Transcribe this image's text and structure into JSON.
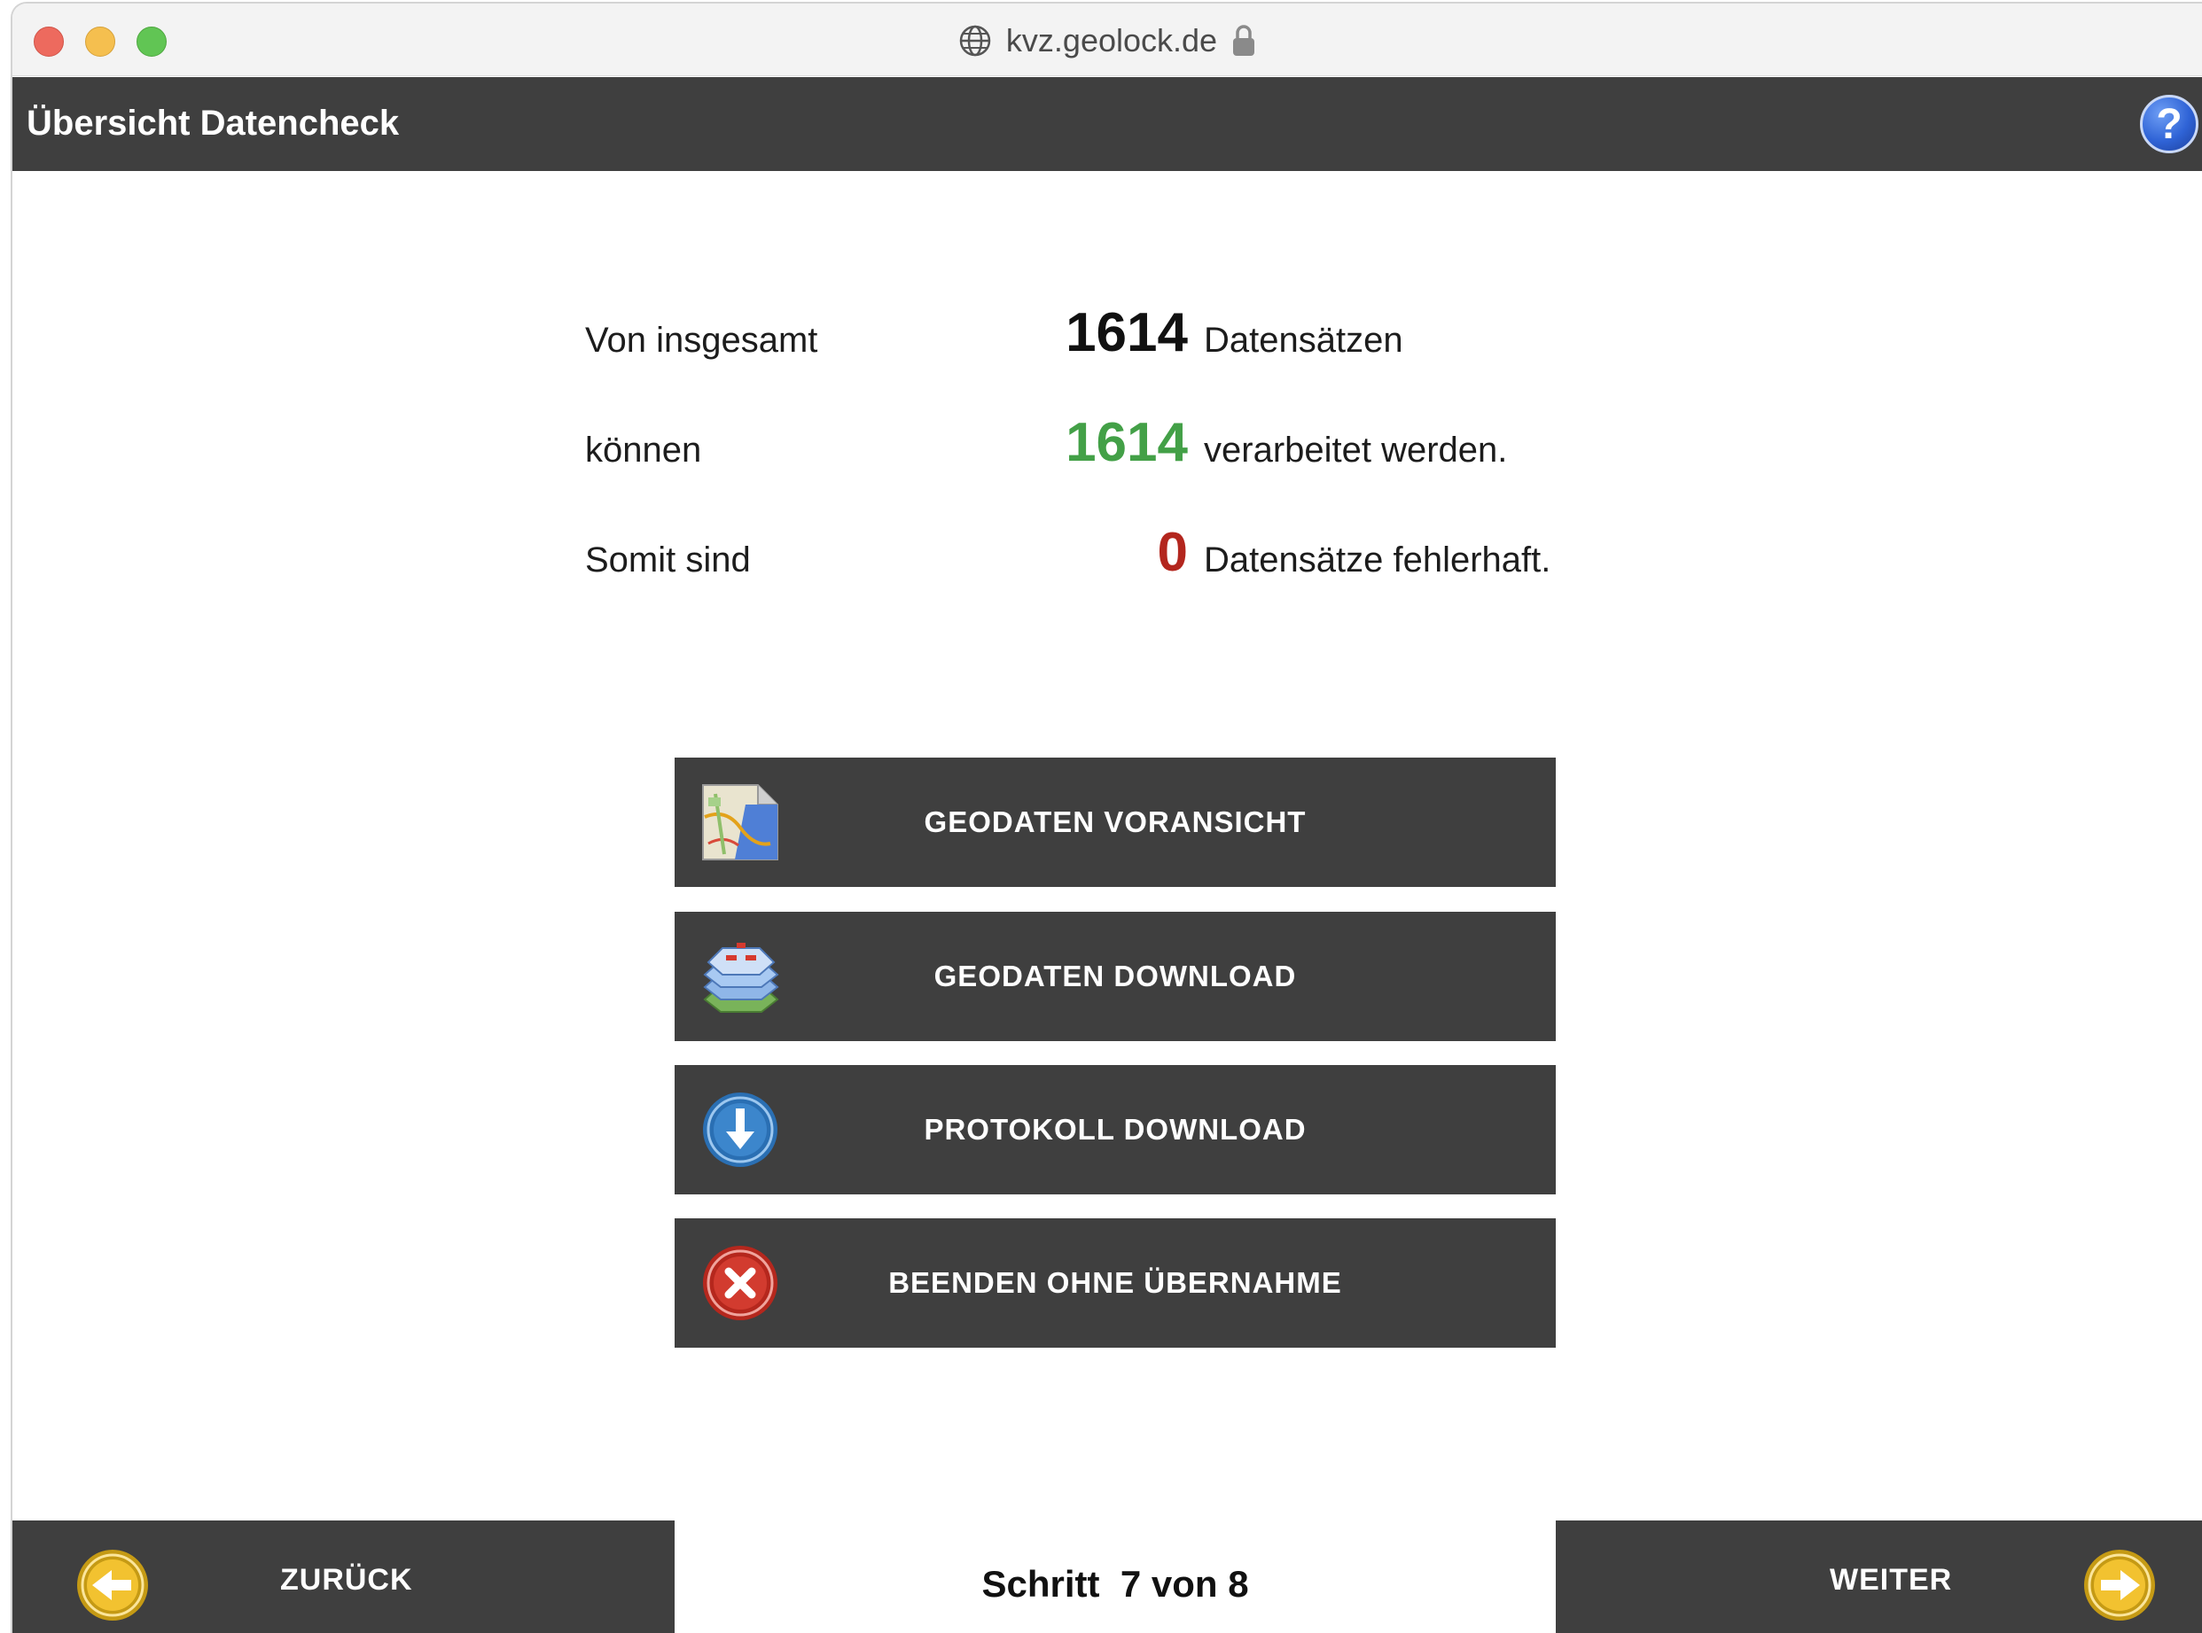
{
  "browser": {
    "url": "kvz.geolock.de"
  },
  "header": {
    "title": "Übersicht Datencheck",
    "help_label": "?"
  },
  "summary": {
    "rows": [
      {
        "label": "Von insgesamt",
        "value": "1614",
        "suffix": "Datensätzen",
        "color": "#111111"
      },
      {
        "label": "können",
        "value": "1614",
        "suffix": "verarbeitet werden.",
        "color": "#43a047"
      },
      {
        "label": "Somit sind",
        "value": "0",
        "suffix": "Datensätze fehlerhaft.",
        "color": "#b3261e"
      }
    ]
  },
  "actions": [
    {
      "label": "GEODATEN VORANSICHT",
      "icon": "map-preview-icon"
    },
    {
      "label": "GEODATEN DOWNLOAD",
      "icon": "map-layers-icon"
    },
    {
      "label": "PROTOKOLL DOWNLOAD",
      "icon": "download-arrow-icon"
    },
    {
      "label": "BEENDEN OHNE ÜBERNAHME",
      "icon": "close-x-icon"
    }
  ],
  "footer": {
    "back_label": "ZURÜCK",
    "next_label": "WEITER",
    "step_prefix": "Schritt",
    "step_current": "7",
    "step_separator": "von",
    "step_total": "8"
  },
  "colors": {
    "bar": "#3f3f3f",
    "accent_yellow": "#f2c230",
    "help_blue": "#2f63d6"
  }
}
